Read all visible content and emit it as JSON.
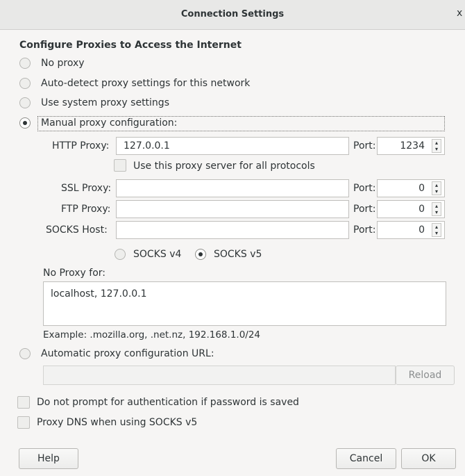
{
  "window": {
    "title": "Connection Settings",
    "close_glyph": "x"
  },
  "heading": "Configure Proxies to Access the Internet",
  "proxy_modes": [
    {
      "label": "No proxy",
      "selected": false
    },
    {
      "label": "Auto-detect proxy settings for this network",
      "selected": false
    },
    {
      "label": "Use system proxy settings",
      "selected": false
    },
    {
      "label": "Manual proxy configuration:",
      "selected": true
    }
  ],
  "manual": {
    "http": {
      "label": "HTTP Proxy:",
      "value": "127.0.0.1",
      "port_label": "Port:",
      "port": "1234"
    },
    "all_protocols": {
      "label": "Use this proxy server for all protocols",
      "checked": false
    },
    "ssl": {
      "label": "SSL Proxy:",
      "value": "",
      "port_label": "Port:",
      "port": "0"
    },
    "ftp": {
      "label": "FTP Proxy:",
      "value": "",
      "port_label": "Port:",
      "port": "0"
    },
    "socks": {
      "label": "SOCKS Host:",
      "value": "",
      "port_label": "Port:",
      "port": "0"
    },
    "socks_versions": [
      {
        "label": "SOCKS v4",
        "selected": false
      },
      {
        "label": "SOCKS v5",
        "selected": true
      }
    ],
    "no_proxy_label": "No Proxy for:",
    "no_proxy_value": "localhost, 127.0.0.1",
    "example": "Example: .mozilla.org, .net.nz, 192.168.1.0/24"
  },
  "auto_config": {
    "label": "Automatic proxy configuration URL:",
    "selected": false,
    "url": "",
    "reload_label": "Reload"
  },
  "options": [
    {
      "label": "Do not prompt for authentication if password is saved",
      "checked": false
    },
    {
      "label": "Proxy DNS when using SOCKS v5",
      "checked": false
    }
  ],
  "buttons": {
    "help": "Help",
    "cancel": "Cancel",
    "ok": "OK"
  },
  "icons": {
    "spin_up": "▴",
    "spin_down": "▾"
  }
}
